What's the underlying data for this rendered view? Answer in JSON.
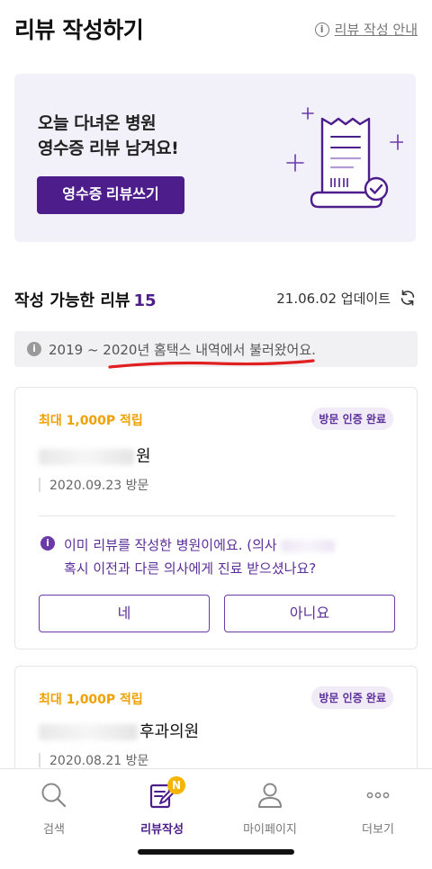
{
  "header": {
    "title": "리뷰 작성하기",
    "guide_label": "리뷰 작성 안내"
  },
  "banner": {
    "line1": "오늘 다녀온 병원",
    "line2": "영수증 리뷰 남겨요!",
    "button_label": "영수증 리뷰쓰기"
  },
  "section": {
    "title": "작성 가능한 리뷰",
    "count": "15",
    "update_text": "21.06.02 업데이트"
  },
  "notice": {
    "text": "2019 ~ 2020년 홈택스 내역에서 불러왔어요."
  },
  "cards": [
    {
      "reward": "최대 1,000P 적립",
      "badge": "방문 인증 완료",
      "hospital_name_visible": "원",
      "visit": "2020.09.23 방문",
      "question_line1": "이미 리뷰를 작성한 병원이에요. (의사",
      "question_line2": "혹시 이전과 다른 의사에게 진료 받으셨나요?",
      "yes_label": "네",
      "no_label": "아니요"
    },
    {
      "reward": "최대 1,000P 적립",
      "badge": "방문 인증 완료",
      "hospital_name_visible": "후과의원",
      "visit": "2020.08.21 방문"
    }
  ],
  "tabbar": {
    "tabs": [
      {
        "label": "검색",
        "icon": "search-icon"
      },
      {
        "label": "리뷰작성",
        "icon": "write-review-icon",
        "badge": "N"
      },
      {
        "label": "마이페이지",
        "icon": "person-icon"
      },
      {
        "label": "더보기",
        "icon": "more-icon"
      }
    ]
  },
  "colors": {
    "brand": "#4d1d8c",
    "reward": "#f0a000",
    "underline_annotation": "#e02020"
  }
}
